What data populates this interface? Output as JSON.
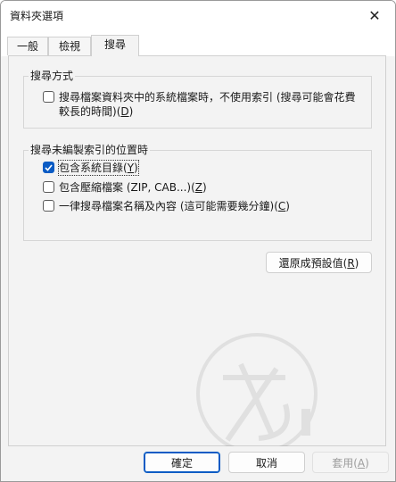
{
  "window": {
    "title": "資料夾選項",
    "close_glyph": "✕"
  },
  "tabs": [
    {
      "label": "一般",
      "active": false
    },
    {
      "label": "檢視",
      "active": false
    },
    {
      "label": "搜尋",
      "active": true
    }
  ],
  "search_method": {
    "title": "搜尋方式",
    "option": {
      "label": "搜尋檔案資料夾中的系統檔案時，不使用索引 (搜尋可能會花費",
      "label_line2": "較長的時間)",
      "mnemonic": "D",
      "checked": false
    }
  },
  "non_indexed": {
    "title": "搜尋未編製索引的位置時",
    "options": [
      {
        "label": "包含系統目錄",
        "mnemonic": "Y",
        "checked": true
      },
      {
        "label": "包含壓縮檔案 (ZIP, CAB...)",
        "mnemonic": "Z",
        "checked": false
      },
      {
        "label": "一律搜尋檔案名稱及內容 (這可能需要幾分鐘)",
        "mnemonic": "C",
        "checked": false
      }
    ]
  },
  "restore_button": {
    "label": "還原成預設值",
    "mnemonic": "R"
  },
  "footer": {
    "ok": "確定",
    "cancel": "取消",
    "apply": "套用",
    "apply_mnemonic": "A"
  },
  "colors": {
    "accent": "#0a5bc4"
  }
}
